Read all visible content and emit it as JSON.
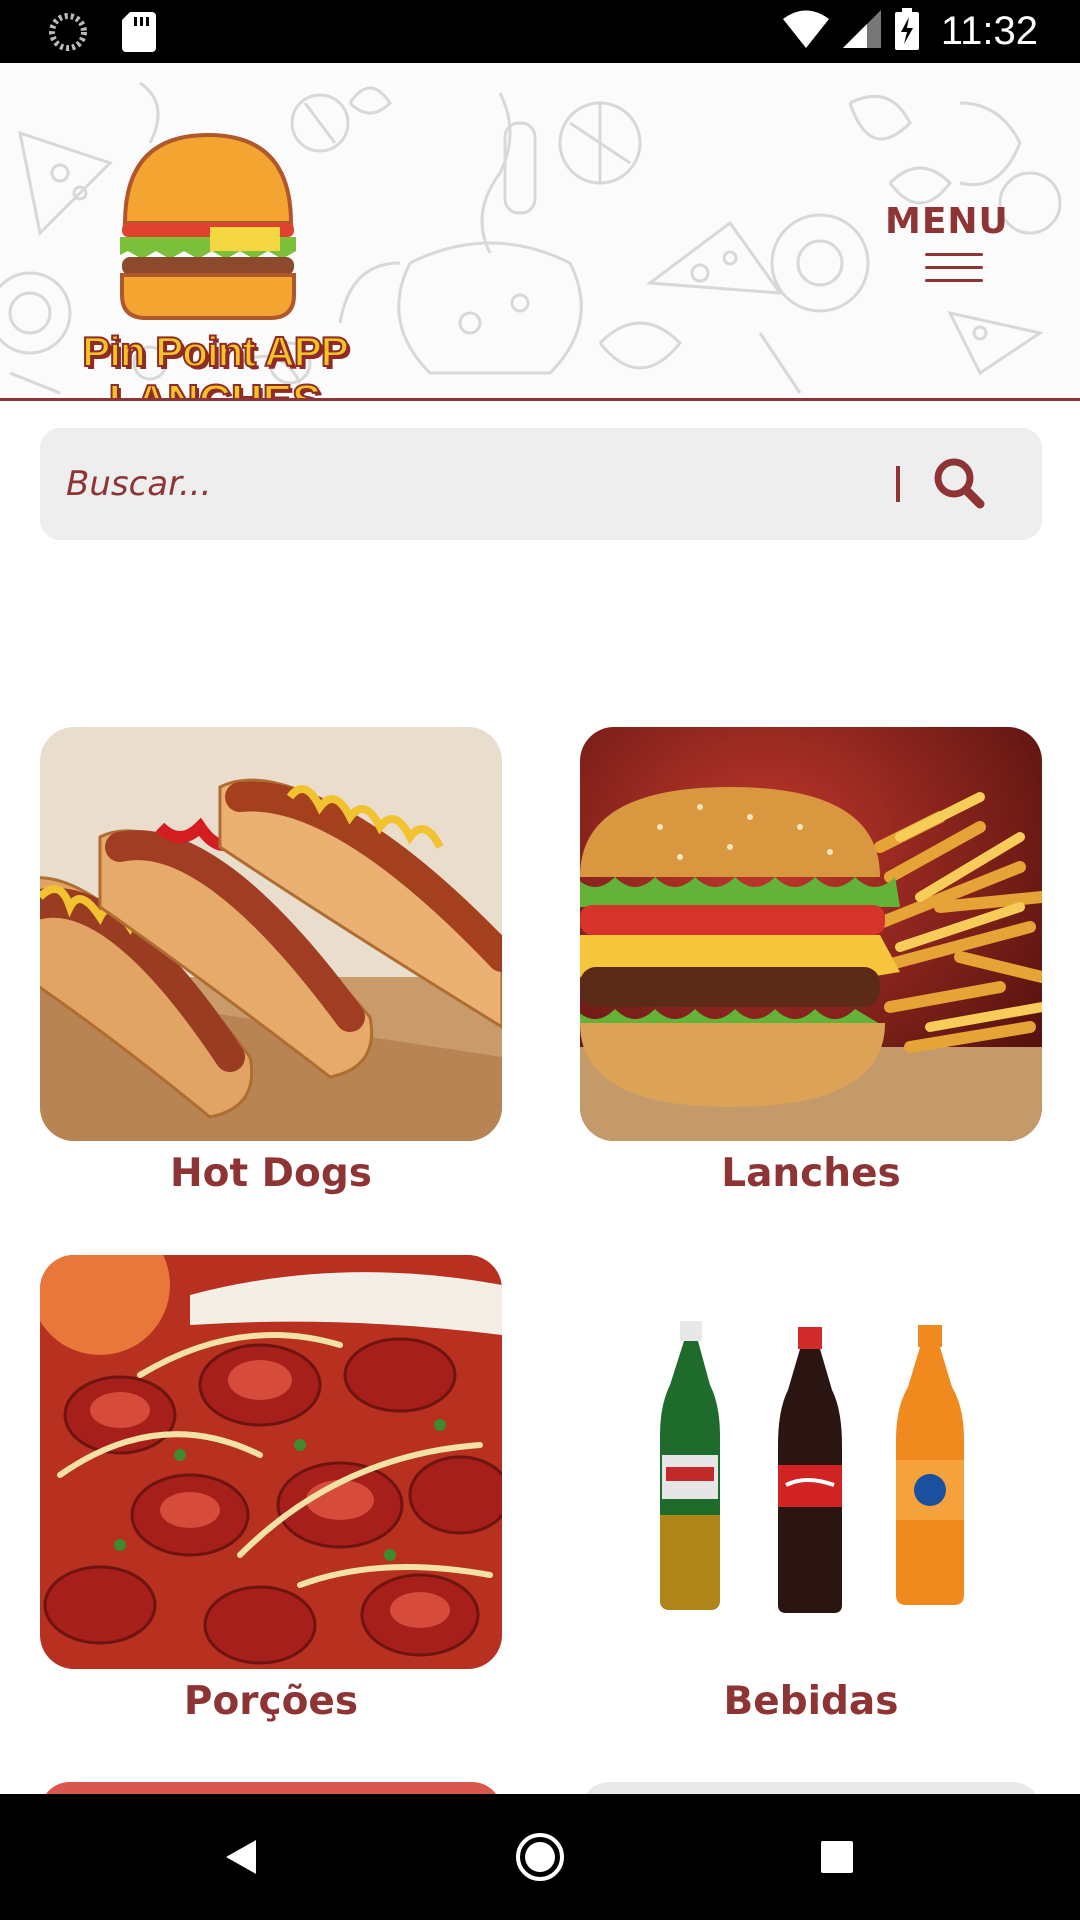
{
  "status_bar": {
    "time": "11:32",
    "icons": [
      "spinner-icon",
      "sd-card-icon",
      "wifi-icon",
      "signal-icon",
      "battery-charging-icon"
    ]
  },
  "header": {
    "logo": {
      "line1": "Pin Point APP",
      "line2": "LANCHES"
    },
    "menu_label": "MENU"
  },
  "search": {
    "placeholder": "Buscar..."
  },
  "categories": [
    {
      "label": "Hot Dogs"
    },
    {
      "label": "Lanches"
    },
    {
      "label": "Porções"
    },
    {
      "label": "Bebidas"
    }
  ],
  "nav": {
    "icons": [
      "back-icon",
      "home-icon",
      "recents-icon"
    ]
  },
  "colors": {
    "brand": "#8e3434",
    "logo_yellow": "#f5c228",
    "search_bg": "#eeeeee"
  }
}
